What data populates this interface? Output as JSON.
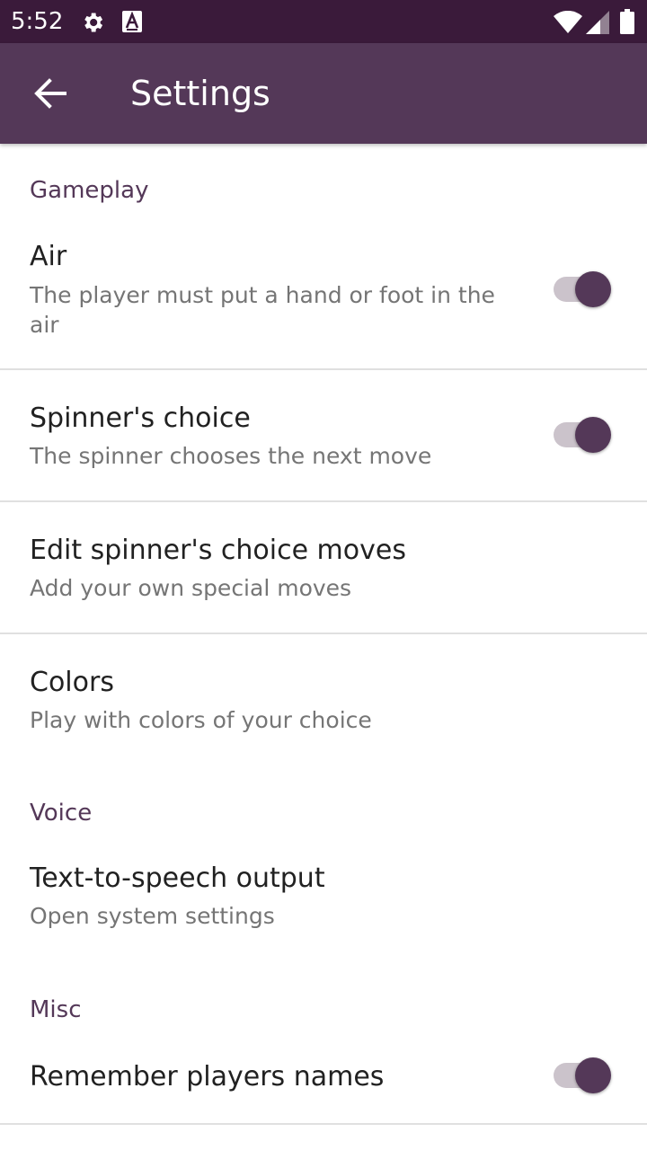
{
  "status_bar": {
    "time": "5:52",
    "icons": [
      "settings-gear-icon",
      "accessibility-a-icon",
      "wifi-icon",
      "signal-icon",
      "battery-icon"
    ]
  },
  "app_bar": {
    "back_icon": "arrow-back-icon",
    "title": "Settings",
    "background": "#543858"
  },
  "colors": {
    "accent": "#543858",
    "status_bar": "#3a1a3a",
    "title_text": "#212121",
    "summary_text": "#757575"
  },
  "sections": {
    "gameplay": {
      "header": "Gameplay",
      "air": {
        "title": "Air",
        "summary": "The player must put a hand or foot in the air",
        "enabled": true
      },
      "spinners_choice": {
        "title": "Spinner's choice",
        "summary": "The spinner chooses the next move",
        "enabled": true
      },
      "edit_moves": {
        "title": "Edit spinner's choice moves",
        "summary": "Add your own special moves"
      },
      "colors": {
        "title": "Colors",
        "summary": "Play with colors of your choice"
      }
    },
    "voice": {
      "header": "Voice",
      "tts": {
        "title": "Text-to-speech output",
        "summary": "Open system settings"
      }
    },
    "misc": {
      "header": "Misc",
      "remember_names": {
        "title": "Remember players names",
        "enabled": true
      }
    }
  }
}
